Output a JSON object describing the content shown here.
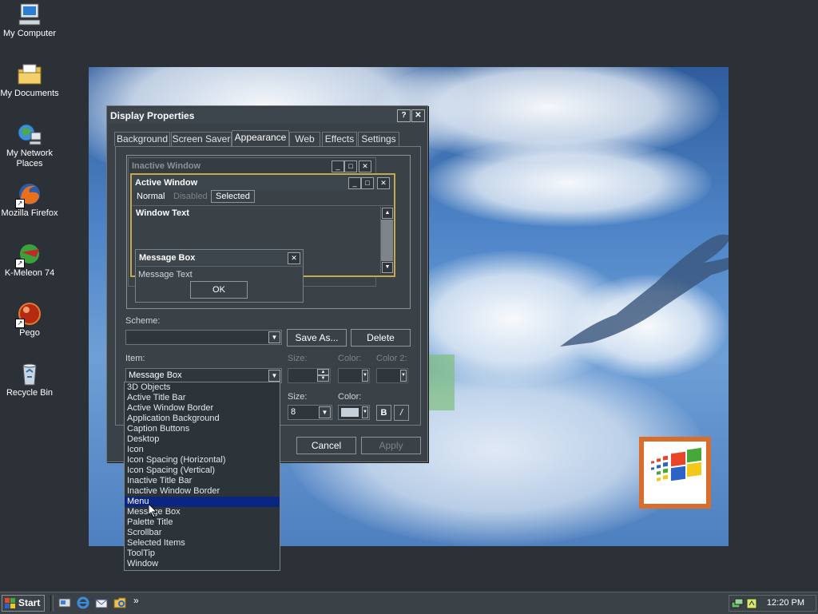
{
  "desktop": {
    "icons": [
      {
        "label": "My Computer",
        "icon": "computer-icon"
      },
      {
        "label": "My Documents",
        "icon": "documents-folder-icon"
      },
      {
        "label": "My Network Places",
        "icon": "network-places-icon"
      },
      {
        "label": "Mozilla Firefox",
        "icon": "firefox-icon"
      },
      {
        "label": "K-Meleon 74",
        "icon": "k-meleon-icon"
      },
      {
        "label": "Pego",
        "icon": "pego-icon"
      },
      {
        "label": "Recycle Bin",
        "icon": "recycle-bin-icon"
      }
    ]
  },
  "dialog": {
    "title": "Display Properties",
    "help_btn": "?",
    "close_btn": "✕",
    "tabs": [
      "Background",
      "Screen Saver",
      "Appearance",
      "Web",
      "Effects",
      "Settings"
    ],
    "selected_tab": "Appearance",
    "preview": {
      "inactive_title": "Inactive Window",
      "active_title": "Active Window",
      "menu_normal": "Normal",
      "menu_disabled": "Disabled",
      "menu_selected": "Selected",
      "window_text": "Window Text",
      "msgbox_title": "Message Box",
      "msgbox_text": "Message Text",
      "msgbox_ok": "OK"
    },
    "scheme_label": "Scheme:",
    "scheme_value": "",
    "save_as": "Save As...",
    "delete": "Delete",
    "item_label": "Item:",
    "item_value": "Message Box",
    "size_label": "Size:",
    "color_label": "Color:",
    "color2_label": "Color 2:",
    "font_size_label": "Size:",
    "font_size_value": "8",
    "font_color_label": "Color:",
    "bold_label": "B",
    "italic_label": "/",
    "cancel": "Cancel",
    "apply": "Apply",
    "item_options": [
      "3D Objects",
      "Active Title Bar",
      "Active Window Border",
      "Application Background",
      "Caption Buttons",
      "Desktop",
      "Icon",
      "Icon Spacing (Horizontal)",
      "Icon Spacing (Vertical)",
      "Inactive Title Bar",
      "Inactive Window Border",
      "Menu",
      "Message Box",
      "Palette Title",
      "Scrollbar",
      "Selected Items",
      "ToolTip",
      "Window"
    ],
    "highlighted_option": "Menu"
  },
  "taskbar": {
    "start_label": "Start",
    "quick_launch": [
      "show-desktop-icon",
      "internet-explorer-icon",
      "outlook-express-icon",
      "explorer-icon"
    ],
    "overflow": "»",
    "clock": "12:20 PM"
  },
  "colors": {
    "desktop_bg": "#2b3136",
    "dialog_bg": "#3a4248",
    "highlight": "#0b2680",
    "active_title_border": "#c8a84e",
    "logo_frame": "#d86d2c"
  }
}
